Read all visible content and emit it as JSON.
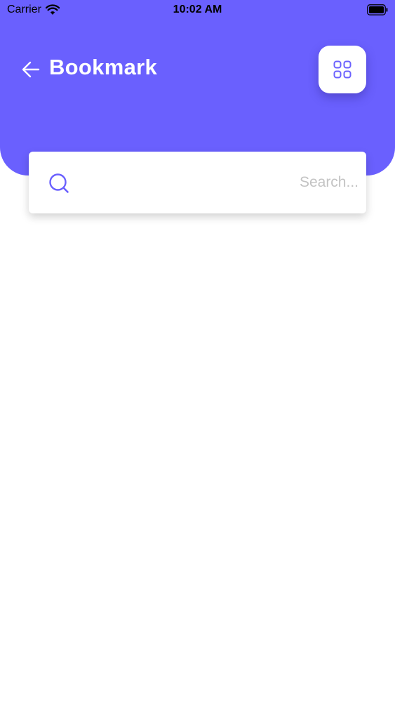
{
  "status_bar": {
    "carrier": "Carrier",
    "time": "10:02 AM"
  },
  "header": {
    "title": "Bookmark",
    "background_color": "#6a60fe"
  },
  "search": {
    "placeholder": "Search...",
    "value": "",
    "icon_color": "#6a60fe"
  },
  "icons": {
    "back": "arrow-left-icon",
    "layout": "grid-icon",
    "search": "search-icon",
    "wifi": "wifi-icon",
    "battery": "battery-icon"
  }
}
